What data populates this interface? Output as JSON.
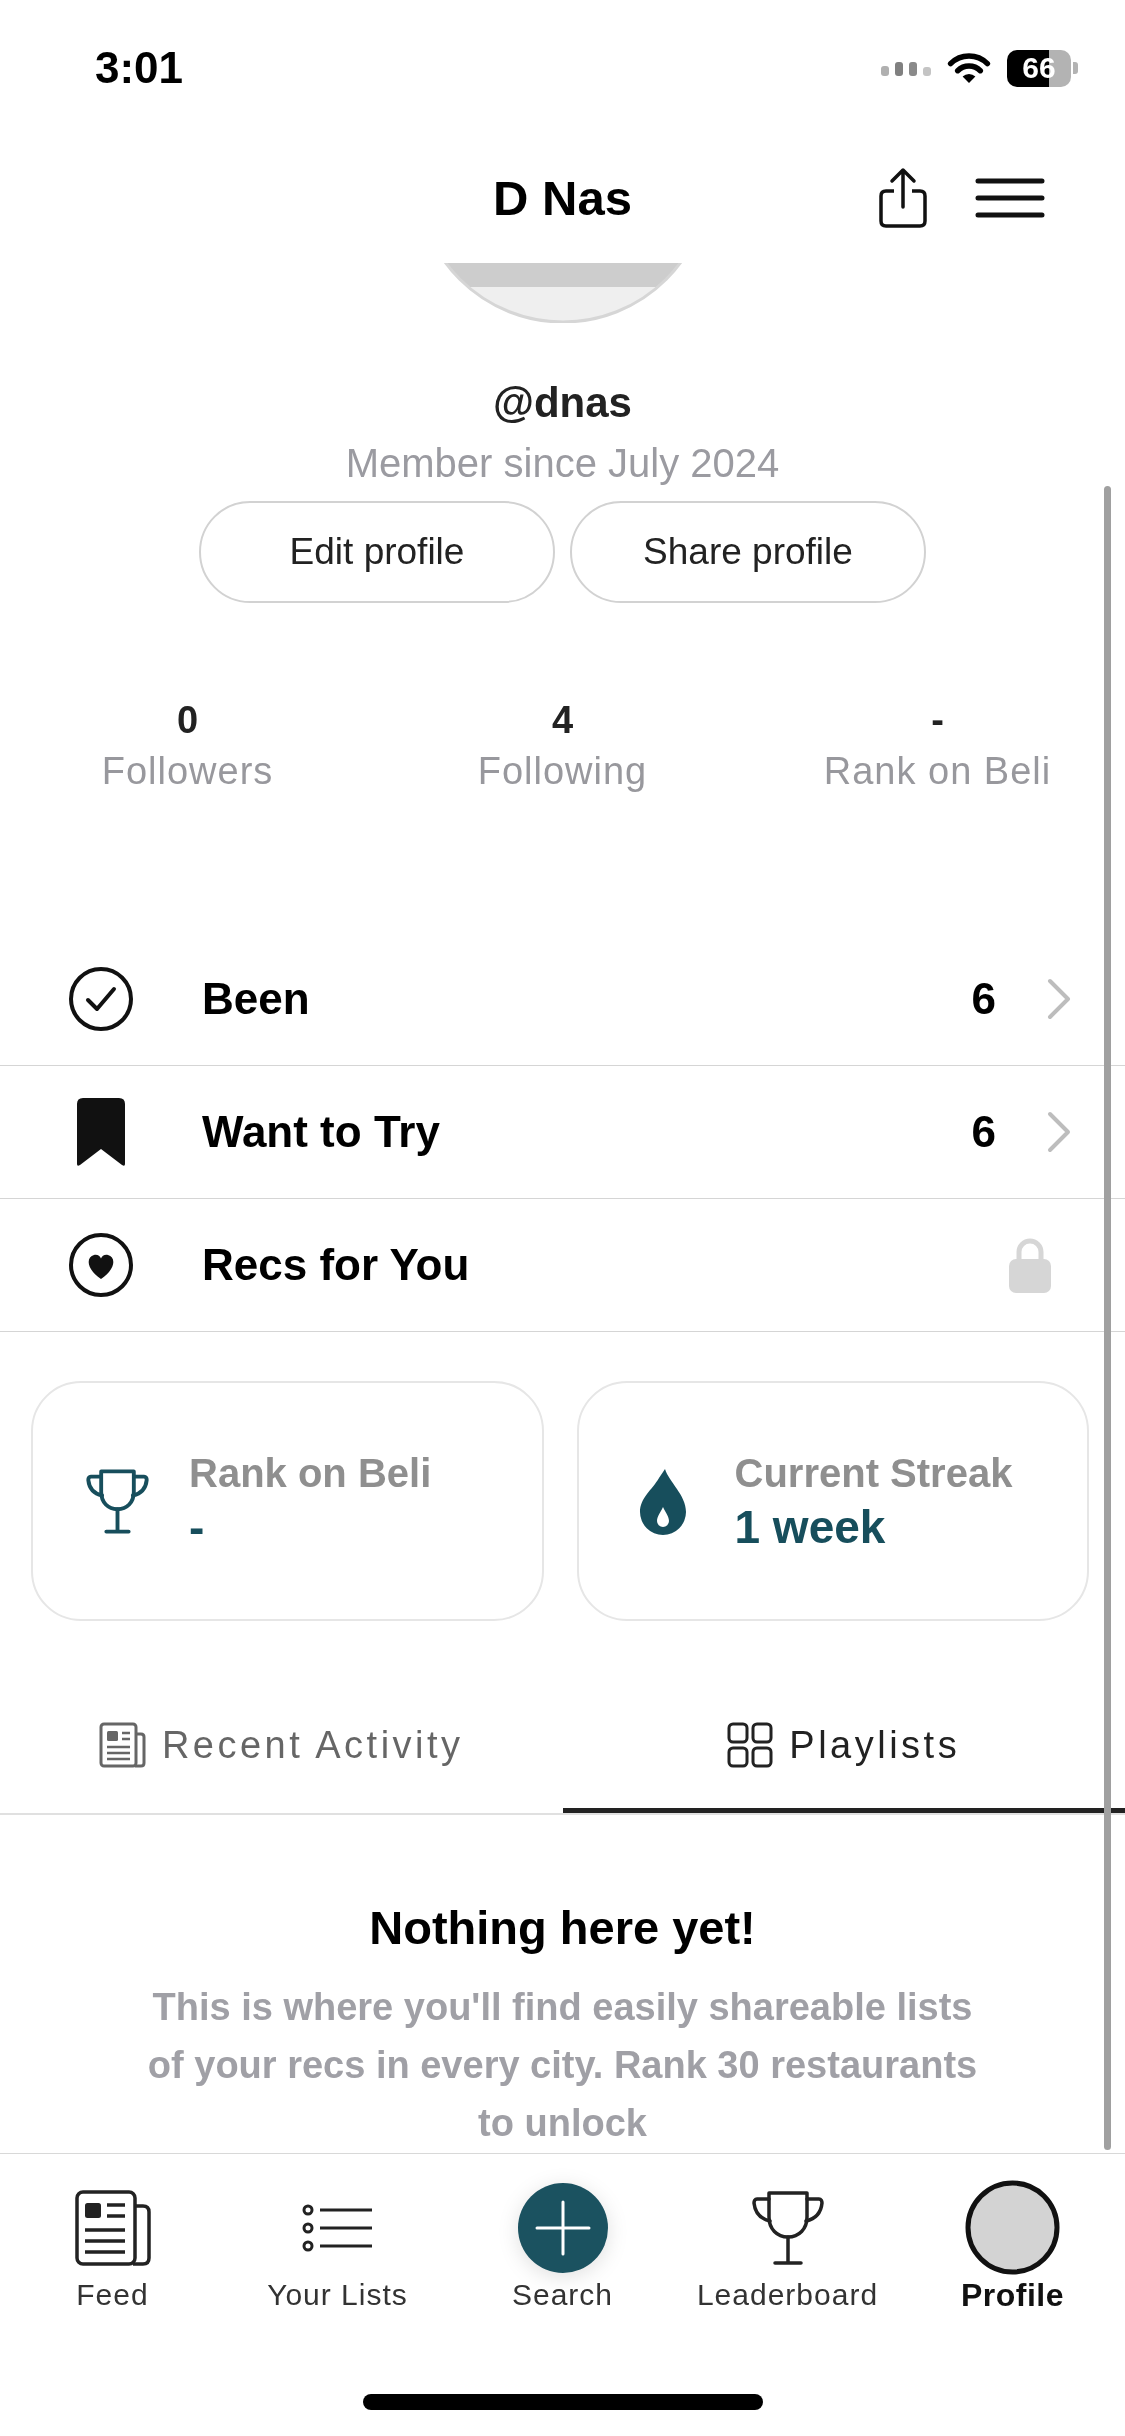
{
  "status_bar": {
    "time": "3:01",
    "battery": "66"
  },
  "header": {
    "title": "D Nas"
  },
  "profile": {
    "handle": "@dnas",
    "member_since": "Member since July 2024",
    "buttons": [
      "Edit profile",
      "Share profile"
    ]
  },
  "stats": [
    {
      "value": "0",
      "label": "Followers"
    },
    {
      "value": "4",
      "label": "Following"
    },
    {
      "value": "-",
      "label": "Rank on Beli"
    }
  ],
  "lists": [
    {
      "label": "Been",
      "count": "6",
      "locked": false
    },
    {
      "label": "Want to Try",
      "count": "6",
      "locked": false
    },
    {
      "label": "Recs for You",
      "locked": true
    }
  ],
  "cards": [
    {
      "label": "Rank on Beli",
      "value": "-"
    },
    {
      "label": "Current Streak",
      "value": "1 week"
    }
  ],
  "tabs": [
    {
      "label": "Recent Activity",
      "selected": false
    },
    {
      "label": "Playlists",
      "selected": true
    }
  ],
  "empty_state": {
    "title": "Nothing here yet!",
    "message": "This is where you'll find easily shareable lists of your recs in every city. Rank 30 restaurants to unlock"
  },
  "tab_bar": [
    {
      "label": "Feed",
      "selected": false
    },
    {
      "label": "Your Lists",
      "selected": false
    },
    {
      "label": "Search",
      "selected": false
    },
    {
      "label": "Leaderboard",
      "selected": false
    },
    {
      "label": "Profile",
      "selected": true
    }
  ]
}
